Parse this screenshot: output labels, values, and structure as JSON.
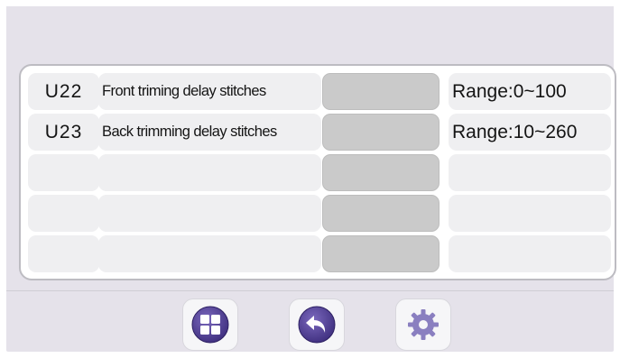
{
  "params": [
    {
      "code": "U22",
      "description": "Front triming delay stitches",
      "value": "",
      "range": "Range:0~100"
    },
    {
      "code": "U23",
      "description": "Back trimming  delay stitches",
      "value": "",
      "range": "Range:10~260"
    },
    {
      "code": "",
      "description": "",
      "value": "",
      "range": ""
    },
    {
      "code": "",
      "description": "",
      "value": "",
      "range": ""
    },
    {
      "code": "",
      "description": "",
      "value": "",
      "range": ""
    }
  ],
  "toolbar": {
    "buttons": [
      {
        "icon": "grid-menu-icon"
      },
      {
        "icon": "back-arrow-icon"
      },
      {
        "icon": "gear-icon"
      }
    ]
  },
  "colors": {
    "screen_background": "#e5e2ea",
    "panel_background": "#ffffff",
    "cell_background": "#efeff1",
    "value_cell": "#cacaca",
    "icon_purple": "#4e3c8f",
    "gear_purple": "#8a7fc0"
  }
}
